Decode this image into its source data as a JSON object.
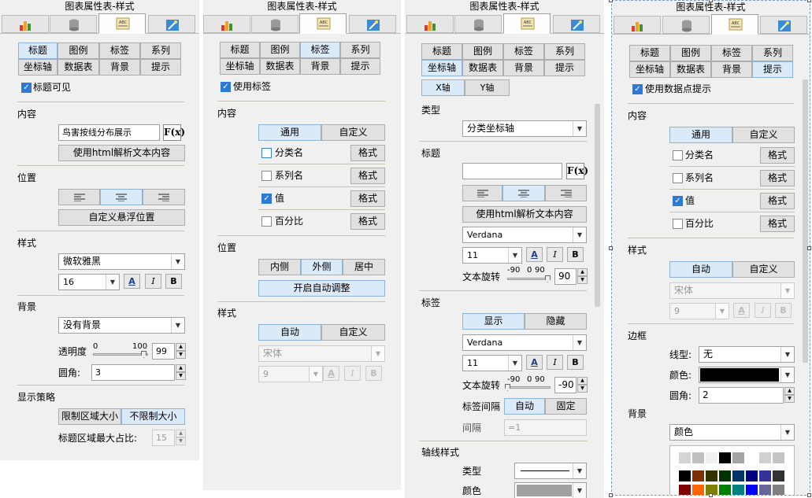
{
  "panel1": {
    "title": "图表属性表-样式",
    "tabs": [
      "标题",
      "图例",
      "标签",
      "系列",
      "坐标轴",
      "数据表",
      "背景",
      "提示"
    ],
    "title_visible": "标题可见",
    "content_label": "内容",
    "content_value": "鸟害按线分布展示",
    "fx": "F(x)",
    "html_btn": "使用html解析文本内容",
    "position_label": "位置",
    "float_btn": "自定义悬浮位置",
    "style_label": "样式",
    "font": "微软雅黑",
    "size": "16",
    "bold": "B",
    "italic": "I",
    "color_btn": "A",
    "bg_label": "背景",
    "bg_value": "没有背景",
    "opacity_label": "透明度",
    "opacity_min": "0",
    "opacity_max": "100",
    "opacity_value": "99",
    "opacity_level": 0.99,
    "radius_label": "圆角:",
    "radius_value": "3",
    "display_label": "显示策略",
    "limit_btn": "限制区域大小",
    "nolimit_btn": "不限制大小",
    "ratio_label": "标题区域最大占比:",
    "ratio_value": "15"
  },
  "panel2": {
    "title": "图表属性表-样式",
    "tabs": [
      "标题",
      "图例",
      "标签",
      "系列",
      "坐标轴",
      "数据表",
      "背景",
      "提示"
    ],
    "use_label": "使用标签",
    "content_label": "内容",
    "general": "通用",
    "custom": "自定义",
    "items": [
      {
        "label": "分类名",
        "checked": false,
        "btn": "格式"
      },
      {
        "label": "系列名",
        "checked": false,
        "btn": "格式"
      },
      {
        "label": "值",
        "checked": true,
        "btn": "格式"
      },
      {
        "label": "百分比",
        "checked": false,
        "btn": "格式"
      }
    ],
    "position_label": "位置",
    "inside": "内侧",
    "outside": "外侧",
    "center": "居中",
    "auto_adjust": "开启自动调整",
    "style_label": "样式",
    "auto": "自动",
    "custom2": "自定义",
    "font": "宋体",
    "size": "9",
    "bold": "B",
    "italic": "I",
    "color_btn": "A"
  },
  "panel3": {
    "title": "图表属性表-样式",
    "tabs": [
      "标题",
      "图例",
      "标签",
      "系列",
      "坐标轴",
      "数据表",
      "背景",
      "提示"
    ],
    "xaxis": "X轴",
    "yaxis": "Y轴",
    "type_label": "类型",
    "type_value": "分类坐标轴",
    "title_label": "标题",
    "fx": "F(x)",
    "html_btn": "使用html解析文本内容",
    "font": "Verdana",
    "size": "11",
    "bold": "B",
    "italic": "I",
    "color_btn": "A",
    "rotate_label": "文本旋转",
    "rot_min": "-90",
    "rot_zero": "0",
    "rot_max": "90",
    "rot_value": "90",
    "rot_level": 1.0,
    "label_label": "标签",
    "show": "显示",
    "hide": "隐藏",
    "font2": "Verdana",
    "size2": "11",
    "rotate_label2": "文本旋转",
    "rot2_value": "-90",
    "rot2_level": 0.0,
    "interval_label": "标签间隔",
    "auto": "自动",
    "fixed": "固定",
    "gap_label": "间隔",
    "gap_value": "=1",
    "line_style_label": "轴线样式",
    "line_type_label": "类型",
    "line_color_label": "颜色"
  },
  "panel4": {
    "title": "图表属性表-样式",
    "tabs": [
      "标题",
      "图例",
      "标签",
      "系列",
      "坐标轴",
      "数据表",
      "背景",
      "提示"
    ],
    "use_tip": "使用数据点提示",
    "content_label": "内容",
    "general": "通用",
    "custom": "自定义",
    "items": [
      {
        "label": "分类名",
        "checked": false,
        "btn": "格式"
      },
      {
        "label": "系列名",
        "checked": false,
        "btn": "格式"
      },
      {
        "label": "值",
        "checked": true,
        "btn": "格式"
      },
      {
        "label": "百分比",
        "checked": false,
        "btn": "格式"
      }
    ],
    "style_label": "样式",
    "auto": "自动",
    "custom2": "自定义",
    "font": "宋体",
    "size": "9",
    "bold": "B",
    "italic": "I",
    "color_btn": "A",
    "border_label": "边框",
    "line_type_label": "线型:",
    "line_type_value": "无",
    "color_label": "颜色:",
    "radius_label": "圆角:",
    "radius_value": "2",
    "bg_label": "背景",
    "bg_value": "颜色",
    "swatches_row1": [
      "#d4d4d4",
      "#c0c0c0",
      "#f0f0f0",
      "#000000",
      "#a5a5a5",
      "#ffffff",
      "#d0d0d0",
      "#c4c4c4"
    ],
    "swatches_row2": [
      "#000000",
      "#7f2f00",
      "#333300",
      "#003300",
      "#003366",
      "#000080",
      "#333399",
      "#333333"
    ],
    "swatches_row3": [
      "#800000",
      "#ff6600",
      "#808000",
      "#008000",
      "#008080",
      "#0000ff",
      "#666699",
      "#808080"
    ]
  }
}
